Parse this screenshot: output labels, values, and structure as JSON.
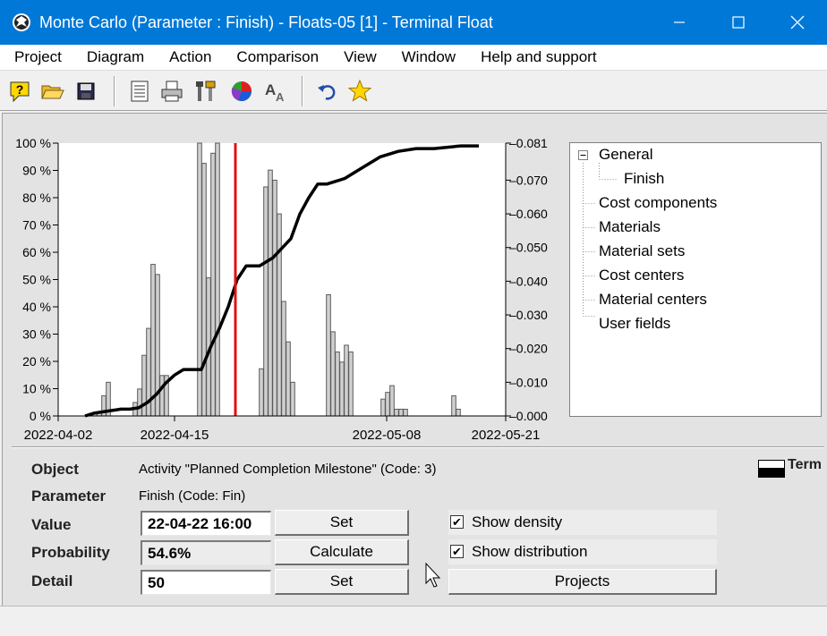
{
  "window": {
    "title": "Monte Carlo (Parameter : Finish) - Floats-05 [1] - Terminal Float"
  },
  "menu": [
    "Project",
    "Diagram",
    "Action",
    "Comparison",
    "View",
    "Window",
    "Help and support"
  ],
  "toolbar_icons": [
    "help-icon",
    "open-folder-icon",
    "save-icon",
    "report-icon",
    "print-icon",
    "tools-icon",
    "pie-chart-icon",
    "font-icon",
    "undo-icon",
    "star-icon"
  ],
  "chart_data": {
    "type": "bar",
    "left_axis": {
      "ticks": [
        "0 %",
        "10 %",
        "20 %",
        "30 %",
        "40 %",
        "50 %",
        "60 %",
        "70 %",
        "80 %",
        "90 %",
        "100 %"
      ],
      "ylim": [
        0,
        100
      ]
    },
    "right_axis": {
      "ticks": [
        "0.000",
        "0.010",
        "0.020",
        "0.030",
        "0.040",
        "0.050",
        "0.060",
        "0.070",
        "0.081"
      ],
      "ylim": [
        0,
        0.081
      ]
    },
    "x_ticks": [
      "2022-04-02",
      "2022-04-15",
      "2022-05-08",
      "2022-05-21"
    ],
    "density_series": {
      "name": "Density",
      "x": [
        4.1,
        4.6,
        5.1,
        5.6,
        8.6,
        9.1,
        9.6,
        10.1,
        10.6,
        11.1,
        11.6,
        12.1,
        15.8,
        16.3,
        16.8,
        17.3,
        17.8,
        22.7,
        23.2,
        23.7,
        24.2,
        24.7,
        25.2,
        25.7,
        26.2,
        30.2,
        30.7,
        31.2,
        31.7,
        32.2,
        32.7,
        36.3,
        36.8,
        37.3,
        37.8,
        38.3,
        38.8,
        44.2,
        44.7
      ],
      "values": [
        0.001,
        0.001,
        0.006,
        0.01,
        0.004,
        0.008,
        0.018,
        0.026,
        0.045,
        0.042,
        0.012,
        0.012,
        0.081,
        0.075,
        0.041,
        0.078,
        0.081,
        0.014,
        0.068,
        0.073,
        0.07,
        0.06,
        0.034,
        0.022,
        0.01,
        0.036,
        0.025,
        0.019,
        0.016,
        0.021,
        0.019,
        0.005,
        0.007,
        0.009,
        0.002,
        0.002,
        0.002,
        0.006,
        0.002
      ]
    },
    "distribution_series": {
      "name": "Distribution",
      "x": [
        3.0,
        4.0,
        5.0,
        6.0,
        7.0,
        8.0,
        9.0,
        10.0,
        11.0,
        12.0,
        13.0,
        14.0,
        15.0,
        16.0,
        17.0,
        18.0,
        19.0,
        20.0,
        21.0,
        21.5,
        22.5,
        24.0,
        26.0,
        27.0,
        28.0,
        29.0,
        30.0,
        32.0,
        34.0,
        36.0,
        38.0,
        40.0,
        42.0,
        45.0,
        47.0
      ],
      "values": [
        0,
        1,
        1.5,
        2,
        2.5,
        2.5,
        3,
        5,
        8,
        12,
        15,
        17,
        17,
        17,
        25,
        32,
        40,
        50,
        55,
        55,
        55,
        58,
        65,
        74,
        80,
        85,
        85,
        87,
        91,
        95,
        97,
        98,
        98,
        99,
        99
      ]
    },
    "marker_x": 19.8,
    "xlim": [
      0,
      50
    ],
    "grid": false
  },
  "tree": {
    "items": [
      {
        "label": "General",
        "level": 0,
        "expanded": true
      },
      {
        "label": "Finish",
        "level": 1
      },
      {
        "label": "Cost components",
        "level": 0
      },
      {
        "label": "Materials",
        "level": 0
      },
      {
        "label": "Material sets",
        "level": 0
      },
      {
        "label": "Cost centers",
        "level": 0
      },
      {
        "label": "Material centers",
        "level": 0
      },
      {
        "label": "User fields",
        "level": 0
      }
    ]
  },
  "form": {
    "object_label": "Object",
    "object_value": "Activity \"Planned Completion Milestone\" (Code: 3)",
    "parameter_label": "Parameter",
    "parameter_value": "Finish (Code: Fin)",
    "value_label": "Value",
    "value_input": "22-04-22  16:00",
    "value_button": "Set",
    "probability_label": "Probability",
    "probability_value": "54.6%",
    "probability_button": "Calculate",
    "detail_label": "Detail",
    "detail_input": "50",
    "detail_button": "Set",
    "show_density_label": "Show density",
    "show_density_checked": true,
    "show_distribution_label": "Show distribution",
    "show_distribution_checked": true,
    "projects_button": "Projects",
    "legend_label": "Term"
  }
}
